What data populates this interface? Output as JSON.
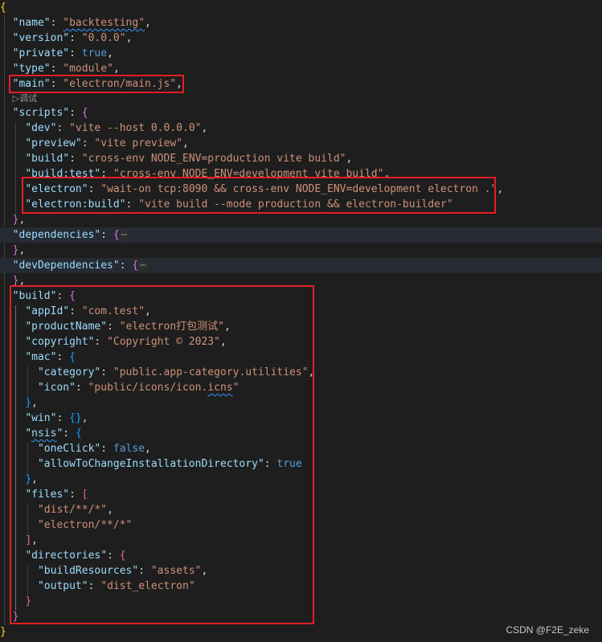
{
  "json_lines": {
    "l0": "{",
    "name_key": "\"name\"",
    "name_val": "\"backtesting\"",
    "version_key": "\"version\"",
    "version_val": "\"0.0.0\"",
    "private_key": "\"private\"",
    "private_val": "true",
    "type_key": "\"type\"",
    "type_val": "\"module\"",
    "main_key": "\"main\"",
    "main_val": "\"electron/main.js\"",
    "codelens_debug": "▷调试",
    "scripts_key": "\"scripts\"",
    "dev_key": "\"dev\"",
    "dev_val": "\"vite --host 0.0.0.0\"",
    "preview_key": "\"preview\"",
    "preview_val": "\"vite preview\"",
    "build_key": "\"build\"",
    "build_val": "\"cross-env NODE_ENV=production vite build\"",
    "buildtest_key": "\"build:test\"",
    "buildtest_val": "\"cross-env NODE_ENV=development vite build\"",
    "electron_key": "\"electron\"",
    "electron_val": "\"wait-on tcp:8090 && cross-env NODE_ENV=development electron .\"",
    "electronbuild_key": "\"electron:build\"",
    "electronbuild_val": "\"vite build --mode production && electron-builder\"",
    "dependencies_key": "\"dependencies\"",
    "devdependencies_key": "\"devDependencies\"",
    "folded_ellipsis": "⋯",
    "buildcfg_key": "\"build\"",
    "appid_key": "\"appId\"",
    "appid_val": "\"com.test\"",
    "productname_key": "\"productName\"",
    "productname_val": "\"electron打包测试\"",
    "copyright_key": "\"copyright\"",
    "copyright_val": "\"Copyright © 2023\"",
    "mac_key": "\"mac\"",
    "category_key": "\"category\"",
    "category_val": "\"public.app-category.utilities\"",
    "icon_key": "\"icon\"",
    "icon_val_pre": "\"public/icons/icon.",
    "icon_val_squig": "icns",
    "icon_val_post": "\"",
    "win_key": "\"win\"",
    "nsis_key_q1": "\"",
    "nsis_key_word": "nsis",
    "nsis_key_q2": "\"",
    "oneclick_key": "\"oneClick\"",
    "oneclick_val": "false",
    "allowchange_key": "\"allowToChangeInstallationDirectory\"",
    "allowchange_val": "true",
    "files_key": "\"files\"",
    "files_item1": "\"dist/**/*\"",
    "files_item2": "\"electron/**/*\"",
    "directories_key": "\"directories\"",
    "buildresources_key": "\"buildResources\"",
    "buildresources_val": "\"assets\"",
    "output_key": "\"output\"",
    "output_val": "\"dist_electron\""
  },
  "watermark": "CSDN @F2E_zeke",
  "colors": {
    "background": "#1e1e1e",
    "key": "#9cdcfe",
    "string": "#ce9178",
    "boolean": "#569cd6",
    "highlight_box": "#e51e25"
  }
}
